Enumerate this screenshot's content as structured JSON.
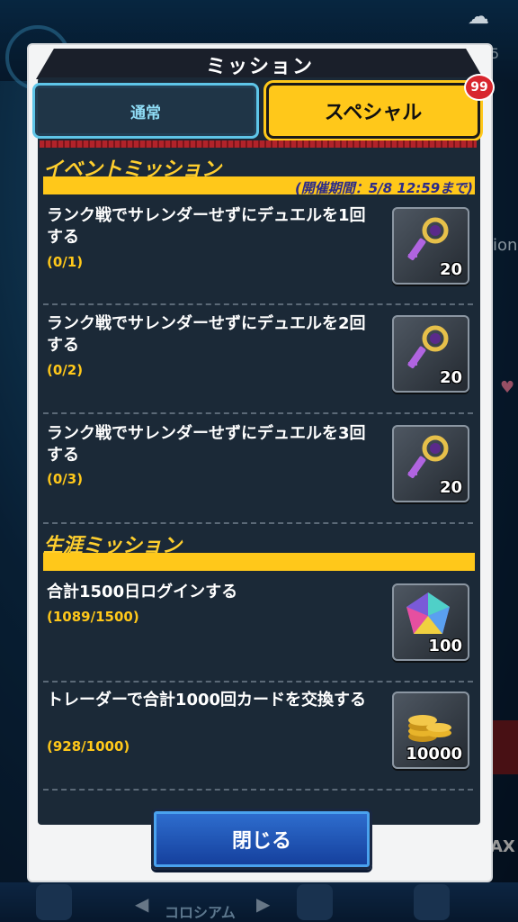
{
  "background": {
    "side_text": "ion",
    "side_number": "5",
    "side_tag": "AX",
    "nav_label": "コロシアム"
  },
  "dialog": {
    "title": "ミッション",
    "tabs": [
      {
        "label": "通常",
        "active": false
      },
      {
        "label": "スペシャル",
        "active": true,
        "badge": "99"
      }
    ],
    "close_label": "閉じる"
  },
  "sections": [
    {
      "title": "イベントミッション",
      "period": "(開催期間：5/8 12:59まで)",
      "missions": [
        {
          "text": "ランク戦でサレンダーせずにデュエルを1回する",
          "progress": "(0/1)",
          "reward_icon": "key-icon",
          "reward_count": "20"
        },
        {
          "text": "ランク戦でサレンダーせずにデュエルを2回する",
          "progress": "(0/2)",
          "reward_icon": "key-icon",
          "reward_count": "20"
        },
        {
          "text": "ランク戦でサレンダーせずにデュエルを3回する",
          "progress": "(0/3)",
          "reward_icon": "key-icon",
          "reward_count": "20"
        }
      ]
    },
    {
      "title": "生涯ミッション",
      "missions": [
        {
          "text": "合計1500日ログインする",
          "progress": "(1089/1500)",
          "reward_icon": "gem-icon",
          "reward_count": "100"
        },
        {
          "text": "トレーダーで合計1000回カードを交換する",
          "progress": "(928/1000)",
          "reward_icon": "gold-coins-icon",
          "reward_count": "10000"
        }
      ]
    }
  ],
  "colors": {
    "accent_yellow": "#ffc81a",
    "panel_dark": "#1b2937",
    "tab_cyan": "#5ec5e8",
    "badge_red": "#d8262e",
    "button_blue": "#2f6fd0"
  }
}
